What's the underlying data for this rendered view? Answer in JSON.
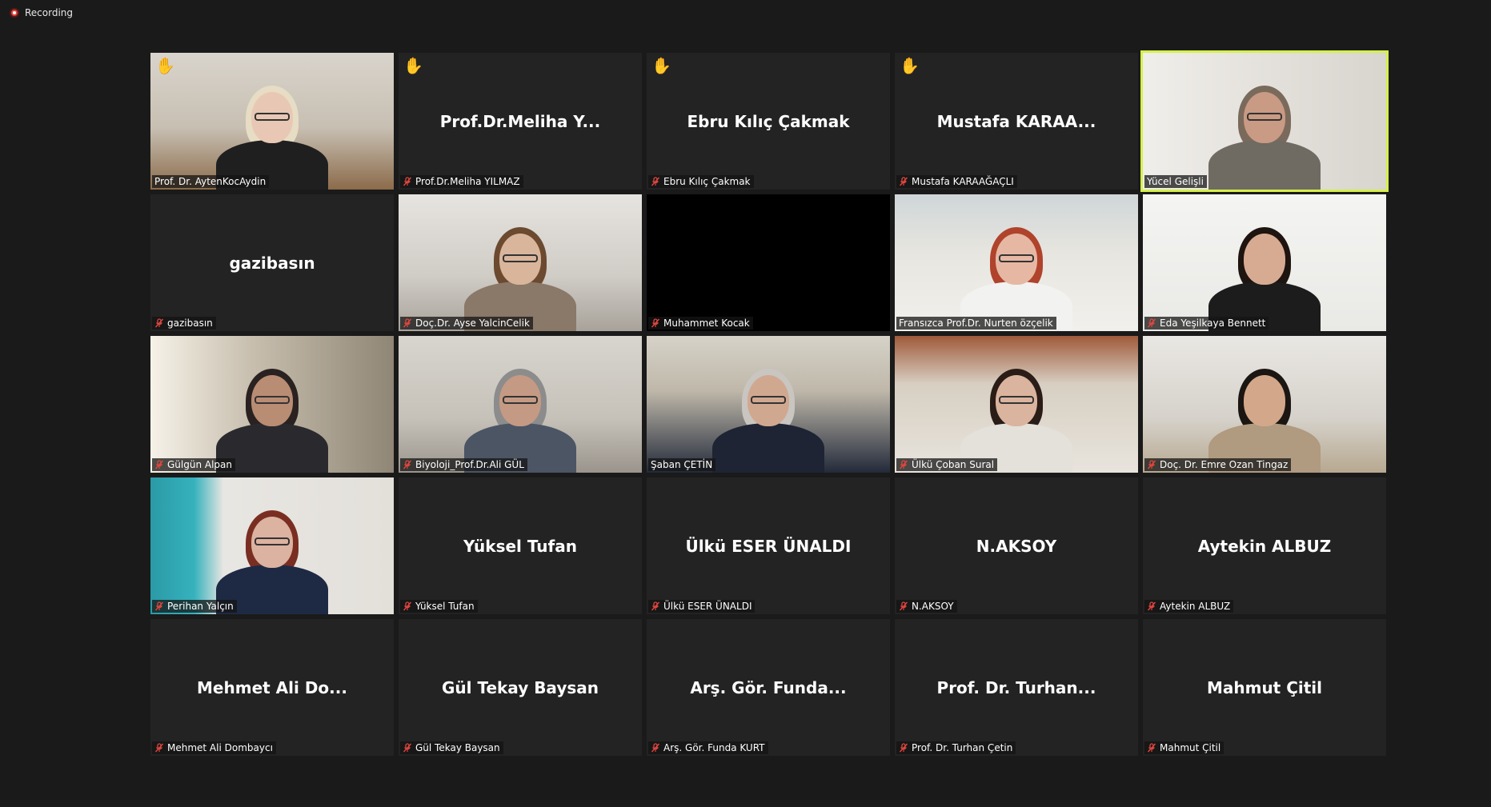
{
  "recording": {
    "label": "Recording",
    "color": "#e5433d"
  },
  "accent_active": "#d6f04a",
  "raise_hand_color": "#f5c518",
  "tiles": [
    {
      "name": "Prof. Dr. AytenKocAydin",
      "center": "",
      "video": "v-office",
      "hand": true,
      "muted": false,
      "active": false,
      "person": {
        "skin": "#e8c8b4",
        "hair": "#e7dcc4",
        "body": "#1f1f1f",
        "glasses": true
      }
    },
    {
      "name": "Prof.Dr.Meliha YILMAZ",
      "center": "Prof.Dr.Meliha  Y...",
      "video": "",
      "hand": true,
      "muted": true,
      "active": false
    },
    {
      "name": "Ebru Kılıç Çakmak",
      "center": "Ebru Kılıç Çakmak",
      "video": "",
      "hand": true,
      "muted": true,
      "active": false
    },
    {
      "name": "Mustafa KARAAĞAÇLI",
      "center": "Mustafa  KARAA...",
      "video": "",
      "hand": true,
      "muted": true,
      "active": false
    },
    {
      "name": "Yücel Gelişli",
      "center": "",
      "video": "v-flag",
      "hand": false,
      "muted": false,
      "active": true,
      "person": {
        "skin": "#c99a84",
        "hair": "#7a6a5c",
        "body": "#6f6a62",
        "glasses": true
      }
    },
    {
      "name": "gazibasın",
      "center": "gazibasın",
      "video": "",
      "hand": false,
      "muted": true,
      "active": false
    },
    {
      "name": "Doç.Dr. Ayse YalcinCelik",
      "center": "",
      "video": "v-office2",
      "hand": false,
      "muted": true,
      "active": false,
      "person": {
        "skin": "#d9b59c",
        "hair": "#6b4a30",
        "body": "#8a7868",
        "glasses": true
      }
    },
    {
      "name": "Muhammet Kocak",
      "center": "",
      "video": "v-black",
      "hand": false,
      "muted": true,
      "active": false
    },
    {
      "name": "Fransızca Prof.Dr. Nurten özçelik",
      "center": "",
      "video": "v-red",
      "hand": false,
      "muted": false,
      "active": false,
      "person": {
        "skin": "#e6b8a4",
        "hair": "#b0432c",
        "body": "#f2f2f0",
        "glasses": true
      }
    },
    {
      "name": "Eda Yeşilkaya Bennett",
      "center": "",
      "video": "v-white",
      "hand": false,
      "muted": true,
      "active": false,
      "person": {
        "skin": "#d7ab92",
        "hair": "#1e1410",
        "body": "#1c1c1c",
        "glasses": false
      }
    },
    {
      "name": "Gülgün  Alpan",
      "center": "",
      "video": "v-window",
      "hand": false,
      "muted": true,
      "active": false,
      "person": {
        "skin": "#b98c74",
        "hair": "#2a2220",
        "body": "#2a2a2e",
        "glasses": true
      }
    },
    {
      "name": "Biyoloji_Prof.Dr.Ali GÜL",
      "center": "",
      "video": "v-art",
      "hand": false,
      "muted": true,
      "active": false,
      "person": {
        "skin": "#c49a84",
        "hair": "#8c8c8c",
        "body": "#4c5564",
        "glasses": true
      }
    },
    {
      "name": "Şaban ÇETİN",
      "center": "",
      "video": "v-paint",
      "hand": false,
      "muted": false,
      "active": false,
      "person": {
        "skin": "#d0a890",
        "hair": "#c9c5c0",
        "body": "#1e2433",
        "glasses": true
      }
    },
    {
      "name": "Ülkü Çoban Sural",
      "center": "",
      "video": "v-paint2",
      "hand": false,
      "muted": true,
      "active": false,
      "person": {
        "skin": "#dab49e",
        "hair": "#2a1c16",
        "body": "#e4e0da",
        "glasses": true
      }
    },
    {
      "name": "Doç. Dr. Emre Ozan Tingaz",
      "center": "",
      "video": "v-room",
      "hand": false,
      "muted": true,
      "active": false,
      "person": {
        "skin": "#d3a88a",
        "hair": "#1c1613",
        "body": "#b09a80",
        "glasses": false
      }
    },
    {
      "name": "Perihan Yalçın",
      "center": "",
      "video": "v-teal",
      "hand": false,
      "muted": true,
      "active": false,
      "person": {
        "skin": "#dcb2a0",
        "hair": "#7a2e22",
        "body": "#1e2a44",
        "glasses": true
      }
    },
    {
      "name": "Yüksel Tufan",
      "center": "Yüksel Tufan",
      "video": "",
      "hand": false,
      "muted": true,
      "active": false
    },
    {
      "name": "Ülkü ESER ÜNALDI",
      "center": "Ülkü ESER ÜNALDI",
      "video": "",
      "hand": false,
      "muted": true,
      "active": false
    },
    {
      "name": "N.AKSOY",
      "center": "N.AKSOY",
      "video": "",
      "hand": false,
      "muted": true,
      "active": false
    },
    {
      "name": "Aytekin ALBUZ",
      "center": "Aytekin ALBUZ",
      "video": "",
      "hand": false,
      "muted": true,
      "active": false
    },
    {
      "name": "Mehmet Ali Dombaycı",
      "center": "Mehmet  Ali  Do...",
      "video": "",
      "hand": false,
      "muted": true,
      "active": false
    },
    {
      "name": "Gül Tekay Baysan",
      "center": "Gül Tekay Baysan",
      "video": "",
      "hand": false,
      "muted": true,
      "active": false
    },
    {
      "name": "Arş. Gör. Funda KURT",
      "center": "Arş.  Gör.  Funda...",
      "video": "",
      "hand": false,
      "muted": true,
      "active": false
    },
    {
      "name": "Prof. Dr. Turhan Çetin",
      "center": "Prof.  Dr.  Turhan...",
      "video": "",
      "hand": false,
      "muted": true,
      "active": false
    },
    {
      "name": "Mahmut Çitil",
      "center": "Mahmut Çitil",
      "video": "",
      "hand": false,
      "muted": true,
      "active": false
    }
  ]
}
